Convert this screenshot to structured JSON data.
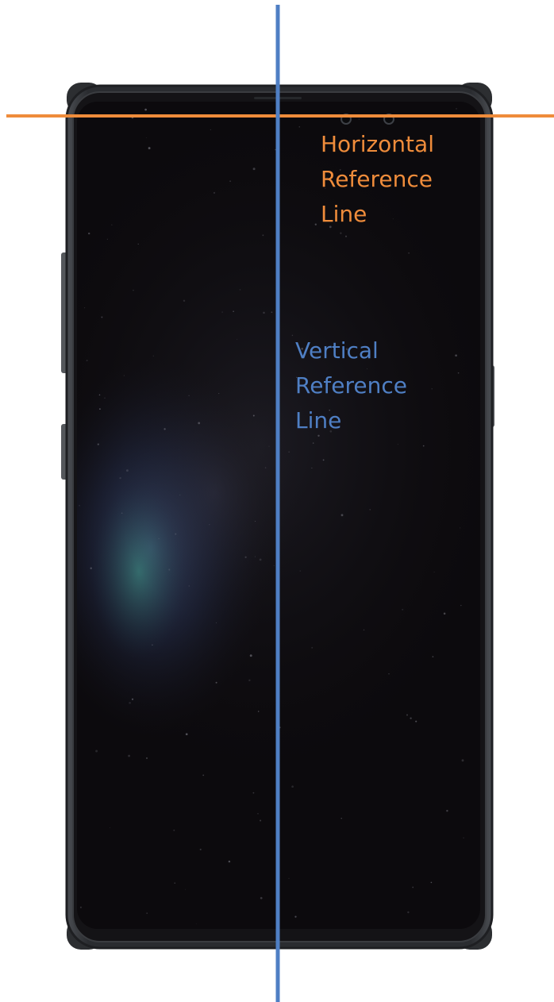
{
  "reference_lines": {
    "horizontal": {
      "label": "Horizontal\nReference\nLine",
      "color": "#ef8c3b"
    },
    "vertical": {
      "label": "Vertical\nReference\nLine",
      "color": "#4f7fc4"
    }
  },
  "device": {
    "bezel_color": "#2c2e31",
    "screen_color": "#0c0a0d",
    "button_color": "#55585c"
  }
}
